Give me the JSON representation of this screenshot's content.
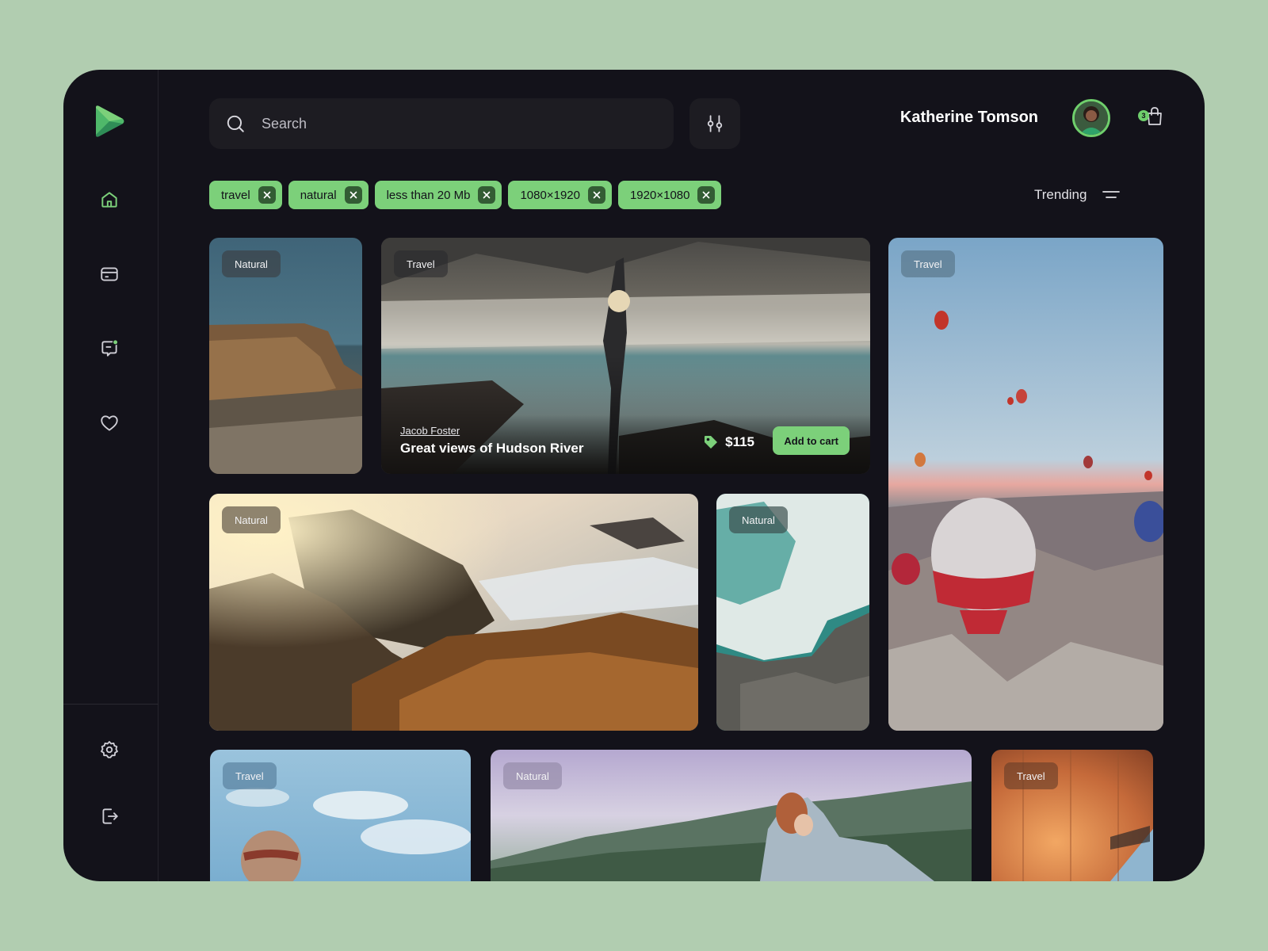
{
  "search": {
    "placeholder": "Search"
  },
  "user": {
    "name": "Katherine Tomson"
  },
  "cart": {
    "count": "3"
  },
  "filters": [
    "travel",
    "natural",
    "less than 20 Mb",
    "1080×1920",
    "1920×1080"
  ],
  "sort": {
    "label": "Trending"
  },
  "cards": [
    {
      "tag": "Natural"
    },
    {
      "tag": "Travel",
      "author": "Jacob Foster",
      "title": "Great views of Hudson River",
      "price": "$115",
      "button": "Add to cart"
    },
    {
      "tag": "Travel"
    },
    {
      "tag": "Natural"
    },
    {
      "tag": "Natural"
    },
    {
      "tag": "Travel"
    },
    {
      "tag": "Natural"
    },
    {
      "tag": "Travel"
    }
  ],
  "colors": {
    "accent": "#7cd07a",
    "panel": "#13121a",
    "background": "#b1cdb0"
  }
}
